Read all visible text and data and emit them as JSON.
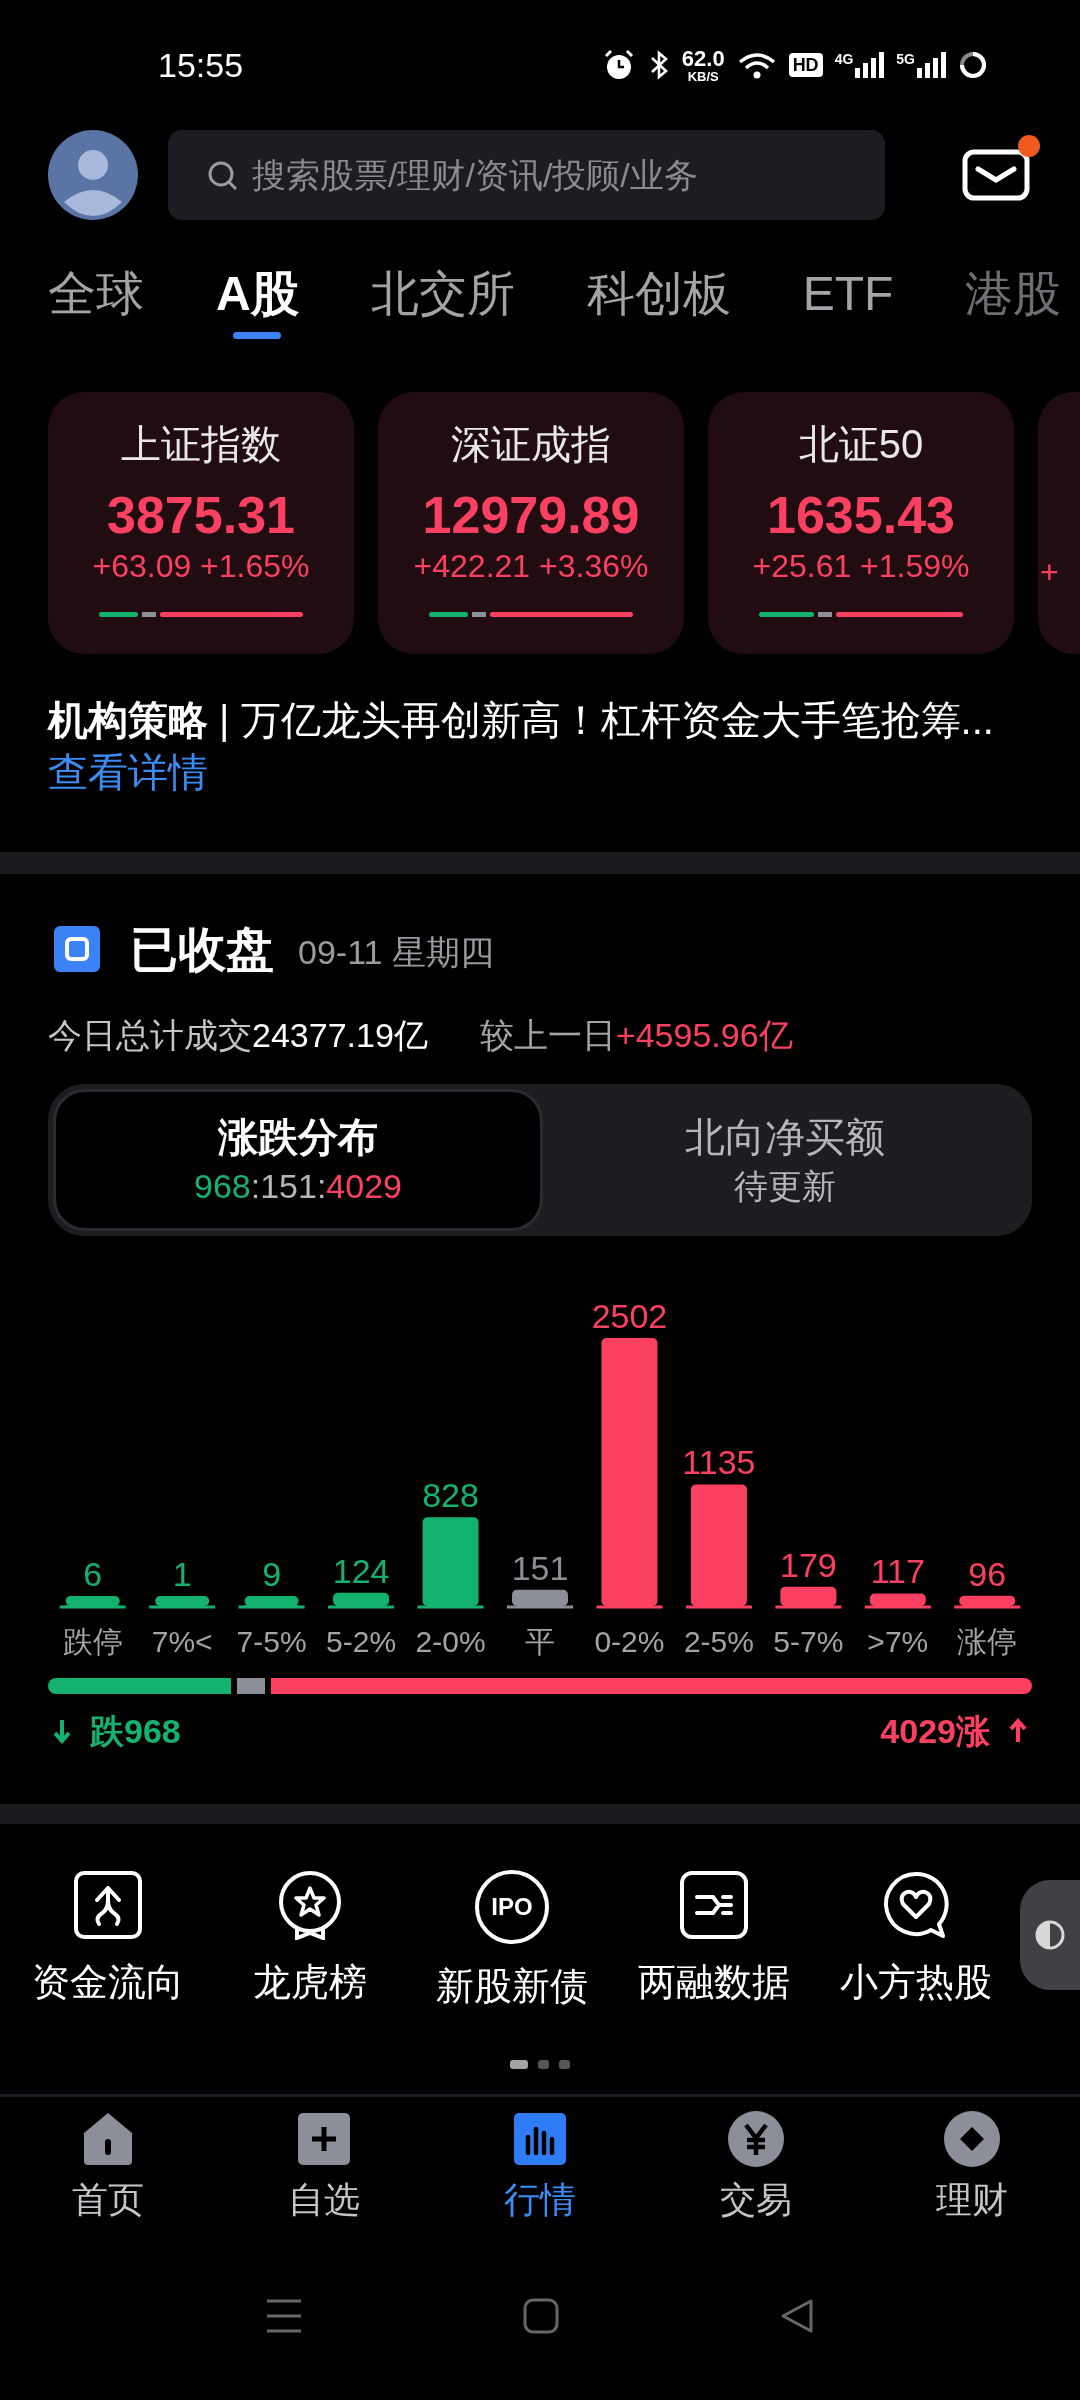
{
  "status_bar": {
    "time": "15:55",
    "speed": "62.0",
    "speed_unit": "KB/S",
    "hd": "HD",
    "networks": [
      "4G",
      "5G"
    ]
  },
  "header": {
    "search": {
      "placeholder": "搜索股票/理财/资讯/投顾/业务"
    },
    "mail": {
      "unread": true
    }
  },
  "tabs": [
    {
      "label": "全球",
      "selected": false
    },
    {
      "label": "A股",
      "selected": true
    },
    {
      "label": "北交所",
      "selected": false
    },
    {
      "label": "科创板",
      "selected": false
    },
    {
      "label": "ETF",
      "selected": false
    },
    {
      "label": "港股",
      "selected": false
    }
  ],
  "index_cards": [
    {
      "name": "上证指数",
      "value": "3875.31",
      "change": "+63.09 +1.65%",
      "level": 0.19
    },
    {
      "name": "深证成指",
      "value": "12979.89",
      "change": "+422.21 +3.36%",
      "level": 0.19
    },
    {
      "name": "北证50",
      "value": "1635.43",
      "change": "+25.61 +1.59%",
      "level": 0.27
    },
    {
      "change": "+"
    }
  ],
  "news": {
    "text": "**机构策略** | 万亿龙头再创新高！杠杆资金大手笔抢筹...",
    "link": "查看详情"
  },
  "market": {
    "status": "已收盘",
    "date": "09-11 星期四",
    "turnover_label": "今日总计成交",
    "turnover": "24377.19亿",
    "compare_label": "较上一日",
    "compare": "+4595.96亿",
    "toggle": [
      {
        "title": "涨跌分布",
        "ratio": "968:151:4029",
        "selected": true
      },
      {
        "title": "北向净买额",
        "subtitle": "待更新",
        "selected": false
      }
    ],
    "chart_data": {
      "type": "bar",
      "categories": [
        "跌停",
        "7%<",
        "7-5%",
        "5-2%",
        "2-0%",
        "平",
        "0-2%",
        "2-5%",
        "5-7%",
        ">7%",
        "涨停"
      ],
      "stacked": true,
      "data_labels": true,
      "series": [
        {
          "color": "#14b26f",
          "values": [
            6,
            1,
            9,
            124,
            828,
            null,
            null,
            null,
            null,
            null,
            null
          ]
        },
        {
          "color": "#8c8f97",
          "values": [
            null,
            null,
            null,
            null,
            null,
            151,
            null,
            null,
            null,
            null,
            null
          ]
        },
        {
          "color": "#fb4061",
          "values": [
            null,
            null,
            null,
            null,
            null,
            null,
            2502,
            1135,
            179,
            117,
            96
          ]
        }
      ]
    },
    "down_total": "跌968",
    "up_total": "4029涨"
  },
  "shortcuts": [
    {
      "label": "资金流向"
    },
    {
      "label": "龙虎榜"
    },
    {
      "label": "新股新债",
      "icon_text": "IPO"
    },
    {
      "label": "两融数据"
    },
    {
      "label": "小方热股"
    }
  ],
  "shortcut_pages": [
    {
      "selected": true
    },
    {
      "selected": false
    },
    {
      "selected": false
    }
  ],
  "bottom_nav": [
    {
      "label": "首页",
      "selected": false
    },
    {
      "label": "自选",
      "selected": false
    },
    {
      "label": "行情",
      "selected": true
    },
    {
      "label": "交易",
      "selected": false
    },
    {
      "label": "理财",
      "selected": false
    }
  ]
}
